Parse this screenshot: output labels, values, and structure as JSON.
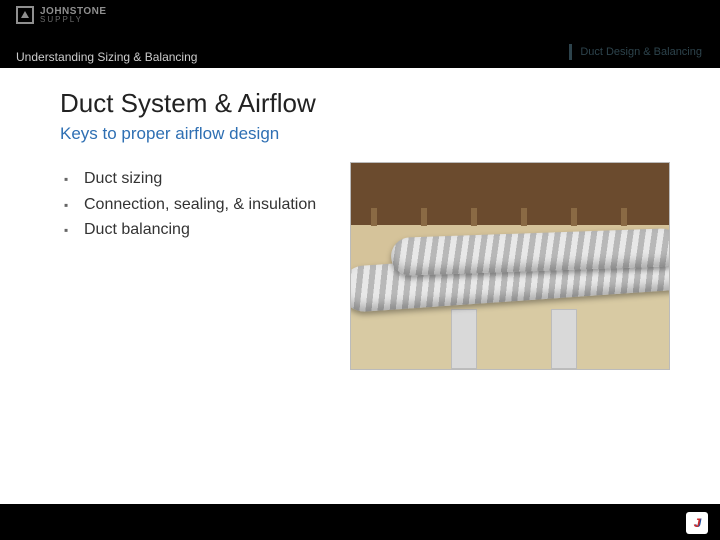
{
  "brand": {
    "line1": "JOHNSTONE",
    "line2": "SUPPLY"
  },
  "breadcrumb": "Understanding Sizing & Balancing",
  "topright_label": "Duct Design & Balancing",
  "title": "Duct System & Airflow",
  "subtitle": "Keys to proper airflow design",
  "bullets": [
    "Duct sizing",
    "Connection, sealing, & insulation",
    "Duct balancing"
  ],
  "image_alt": "Insulated flexible ductwork running through a crawl space",
  "badge_letter": "J",
  "colors": {
    "accent": "#2e6fb3",
    "band": "#000000"
  }
}
